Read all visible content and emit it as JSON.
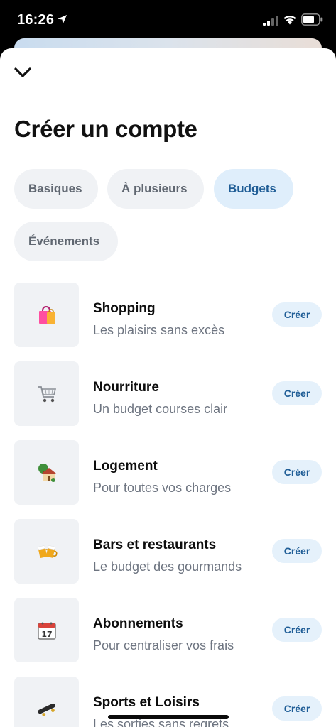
{
  "status_bar": {
    "time": "16:26"
  },
  "header": {
    "title": "Créer un compte"
  },
  "tabs": [
    {
      "label": "Basiques",
      "active": false
    },
    {
      "label": "À plusieurs",
      "active": false
    },
    {
      "label": "Budgets",
      "active": true
    },
    {
      "label": "Événements",
      "active": false
    }
  ],
  "items": [
    {
      "title": "Shopping",
      "subtitle": "Les plaisirs sans excès",
      "icon": "shopping-bags-icon",
      "button": "Créer"
    },
    {
      "title": "Nourriture",
      "subtitle": "Un budget courses clair",
      "icon": "shopping-cart-icon",
      "button": "Créer"
    },
    {
      "title": "Logement",
      "subtitle": "Pour toutes vos charges",
      "icon": "house-icon",
      "button": "Créer"
    },
    {
      "title": "Bars et restaurants",
      "subtitle": "Le budget des gourmands",
      "icon": "beer-mugs-icon",
      "button": "Créer"
    },
    {
      "title": "Abonnements",
      "subtitle": "Pour centraliser vos frais",
      "icon": "calendar-icon",
      "button": "Créer"
    },
    {
      "title": "Sports et Loisirs",
      "subtitle": "Les sorties sans regrets",
      "icon": "skateboard-icon",
      "button": "Créer"
    }
  ],
  "colors": {
    "accent": "#1f5d96",
    "chip_active_bg": "#dfeefb",
    "chip_bg": "#f0f2f5"
  }
}
